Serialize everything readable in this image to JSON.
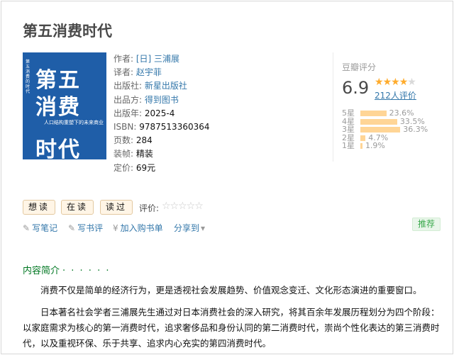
{
  "book": {
    "title": "第五消费时代",
    "cover": {
      "line1": "第五",
      "line2": "消费",
      "subtitle": "人口结构重塑下的未来商业",
      "line3": "时代",
      "side_text": "第五消费的时代"
    },
    "meta": {
      "author_label": "作者:",
      "author": "[日] 三浦展",
      "translator_label": "译者:",
      "translator": "赵宇菲",
      "publisher_label": "出版社:",
      "publisher": "新星出版社",
      "producer_label": "出品方:",
      "producer": "得到图书",
      "pubyear_label": "出版年:",
      "pubyear": "2025-4",
      "isbn_label": "ISBN:",
      "isbn": "9787513360364",
      "pages_label": "页数:",
      "pages": "284",
      "binding_label": "装帧:",
      "binding": "精装",
      "price_label": "定价:",
      "price": "69元"
    }
  },
  "rating": {
    "label": "豆瓣评分",
    "score": "6.9",
    "stars_filled": 3.5,
    "stars_icon": "star-icon",
    "votes": "212人评价",
    "distribution": [
      {
        "label": "5星",
        "percent": 23.6,
        "text": "23.6%"
      },
      {
        "label": "4星",
        "percent": 33.5,
        "text": "33.5%"
      },
      {
        "label": "3星",
        "percent": 36.3,
        "text": "36.3%"
      },
      {
        "label": "2星",
        "percent": 4.7,
        "text": "4.7%"
      },
      {
        "label": "1星",
        "percent": 1.9,
        "text": "1.9%"
      }
    ]
  },
  "interest": {
    "want": "想读",
    "reading": "在读",
    "read": "读过",
    "eval_label": "评价:"
  },
  "actions": {
    "write_note": "写笔记",
    "write_review": "写书评",
    "add_cart": "加入购书单",
    "share": "分享到",
    "recommend": "推荐"
  },
  "intro": {
    "heading": "内容简介",
    "heading_dots": "· · · · · ·",
    "p1": "消费不仅是简单的经济行为，更是透视社会发展趋势、价值观念变迁、文化形态演进的重要窗口。",
    "p2": "日本著名社会学者三浦展先生通过对日本消费社会的深入研究，将其百余年发展历程划分为四个阶段：以家庭需求为核心的第一消费时代，追求奢侈品和身份认同的第二消费时代，崇尚个性化表达的第三消费时代，以及重视环保、乐于共享、追求内心充实的第四消费时代。"
  },
  "colors": {
    "link": "#3377aa",
    "star": "#ffac2d",
    "bar": "#ffd596",
    "green": "#007722",
    "cover": "#1f5ea8"
  }
}
